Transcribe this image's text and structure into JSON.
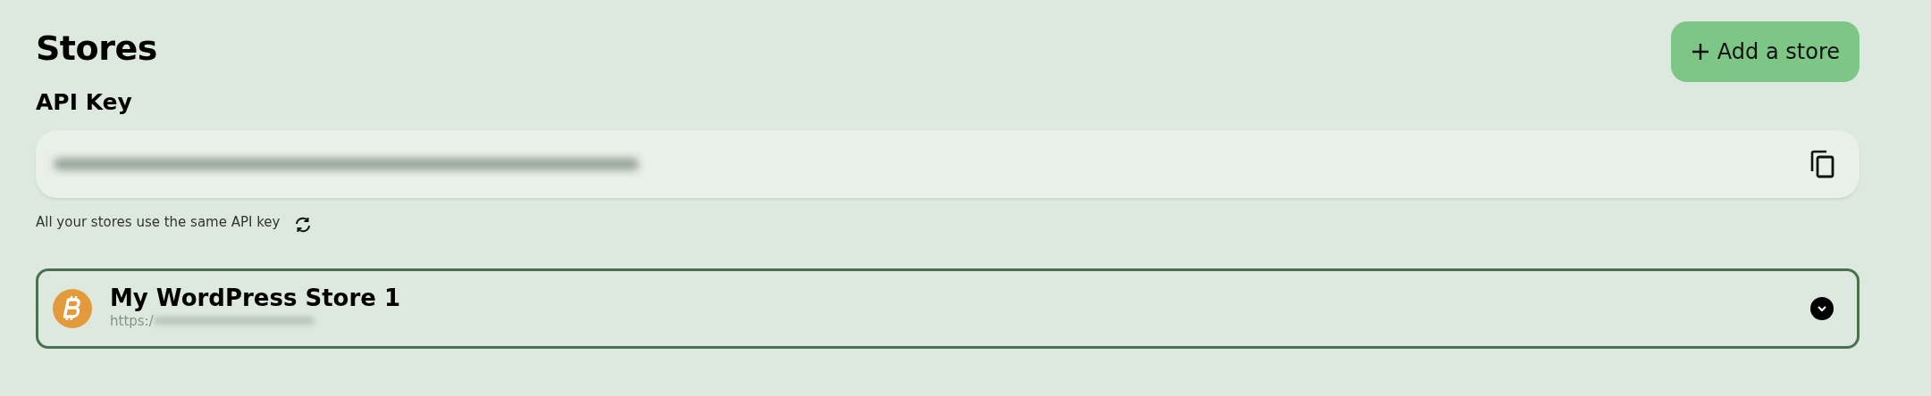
{
  "page": {
    "title": "Stores"
  },
  "add_button": {
    "label": "Add a store"
  },
  "api_key": {
    "label": "API Key",
    "redacted": true,
    "help": "All your stores use the same API key"
  },
  "stores": [
    {
      "name": "My WordPress Store 1",
      "url": "https:/",
      "url_redacted": true,
      "expanded": false
    }
  ]
}
